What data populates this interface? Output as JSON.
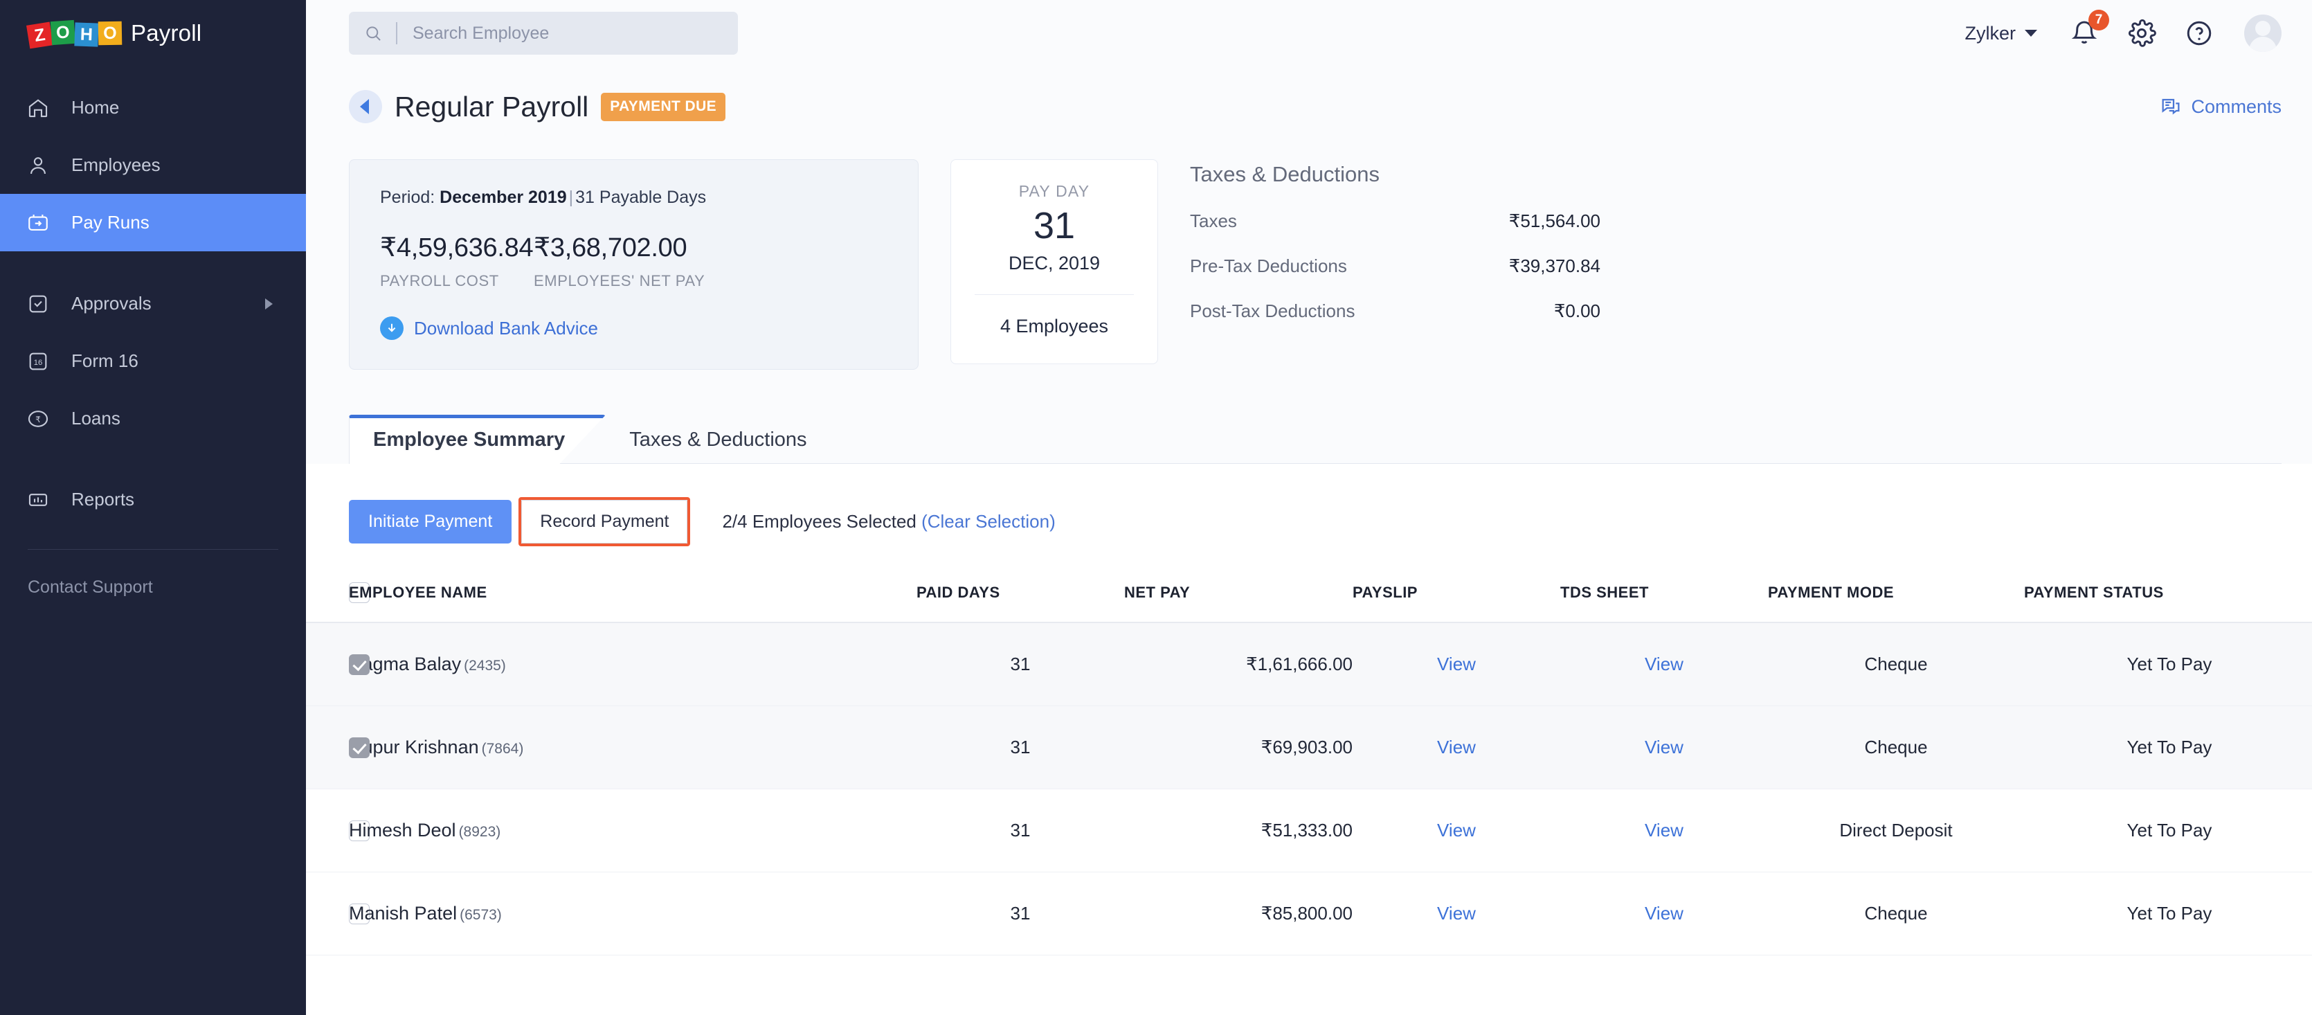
{
  "brand": {
    "logo_letters": [
      "Z",
      "O",
      "H",
      "O"
    ],
    "name": "Payroll"
  },
  "sidebar": {
    "items": [
      {
        "label": "Home",
        "icon": "home-icon"
      },
      {
        "label": "Employees",
        "icon": "user-icon"
      },
      {
        "label": "Pay Runs",
        "icon": "payrun-calendar-icon",
        "active": true
      },
      {
        "label": "Approvals",
        "icon": "check-square-icon",
        "has_submenu": true
      },
      {
        "label": "Form 16",
        "icon": "form16-icon"
      },
      {
        "label": "Loans",
        "icon": "rupee-circle-icon"
      },
      {
        "label": "Reports",
        "icon": "bar-chart-icon"
      }
    ],
    "support_label": "Contact Support"
  },
  "topbar": {
    "search_placeholder": "Search Employee",
    "org_name": "Zylker",
    "notification_count": "7",
    "icons": [
      "bell-icon",
      "gear-icon",
      "help-icon",
      "avatar"
    ]
  },
  "page": {
    "title": "Regular Payroll",
    "status_badge": "PAYMENT DUE",
    "comments_label": "Comments"
  },
  "summary_card": {
    "period_prefix": "Period:",
    "period_value": "December 2019",
    "period_separator": "|",
    "payable_days": "31 Payable Days",
    "payroll_cost_value": "₹4,59,636.84",
    "payroll_cost_label": "PAYROLL COST",
    "net_pay_value": "₹3,68,702.00",
    "net_pay_label": "EMPLOYEES' NET PAY",
    "download_label": "Download Bank Advice"
  },
  "payday_card": {
    "label": "PAY DAY",
    "day": "31",
    "month_year": "DEC, 2019",
    "employees": "4 Employees"
  },
  "taxes_panel": {
    "title": "Taxes & Deductions",
    "rows": [
      {
        "name": "Taxes",
        "value": "₹51,564.00"
      },
      {
        "name": "Pre-Tax Deductions",
        "value": "₹39,370.84"
      },
      {
        "name": "Post-Tax Deductions",
        "value": "₹0.00"
      }
    ]
  },
  "tabs": [
    {
      "label": "Employee Summary",
      "active": true
    },
    {
      "label": "Taxes & Deductions",
      "active": false
    }
  ],
  "actions": {
    "initiate_payment": "Initiate Payment",
    "record_payment": "Record Payment",
    "selection_text": "2/4 Employees Selected",
    "clear_selection": "(Clear Selection)",
    "highlight_color": "#f05a33"
  },
  "table": {
    "columns": [
      "EMPLOYEE NAME",
      "PAID DAYS",
      "NET PAY",
      "PAYSLIP",
      "TDS SHEET",
      "PAYMENT MODE",
      "PAYMENT STATUS"
    ],
    "rows": [
      {
        "selected": true,
        "name": "Nagma Balay",
        "id": "(2435)",
        "paid_days": "31",
        "net_pay": "₹1,61,666.00",
        "payslip": "View",
        "tds": "View",
        "mode": "Cheque",
        "status": "Yet To Pay"
      },
      {
        "selected": true,
        "name": "Nupur Krishnan",
        "id": "(7864)",
        "paid_days": "31",
        "net_pay": "₹69,903.00",
        "payslip": "View",
        "tds": "View",
        "mode": "Cheque",
        "status": "Yet To Pay"
      },
      {
        "selected": false,
        "name": "Himesh Deol",
        "id": "(8923)",
        "paid_days": "31",
        "net_pay": "₹51,333.00",
        "payslip": "View",
        "tds": "View",
        "mode": "Direct Deposit",
        "status": "Yet To Pay"
      },
      {
        "selected": false,
        "name": "Manish Patel",
        "id": "(6573)",
        "paid_days": "31",
        "net_pay": "₹85,800.00",
        "payslip": "View",
        "tds": "View",
        "mode": "Cheque",
        "status": "Yet To Pay"
      }
    ]
  },
  "colors": {
    "sidebar_bg": "#1e2339",
    "accent_blue": "#5c8df7",
    "link_blue": "#3d72d8",
    "badge_orange": "#f0a04b",
    "notification_red": "#e8562c",
    "highlight_red": "#f05a33"
  }
}
